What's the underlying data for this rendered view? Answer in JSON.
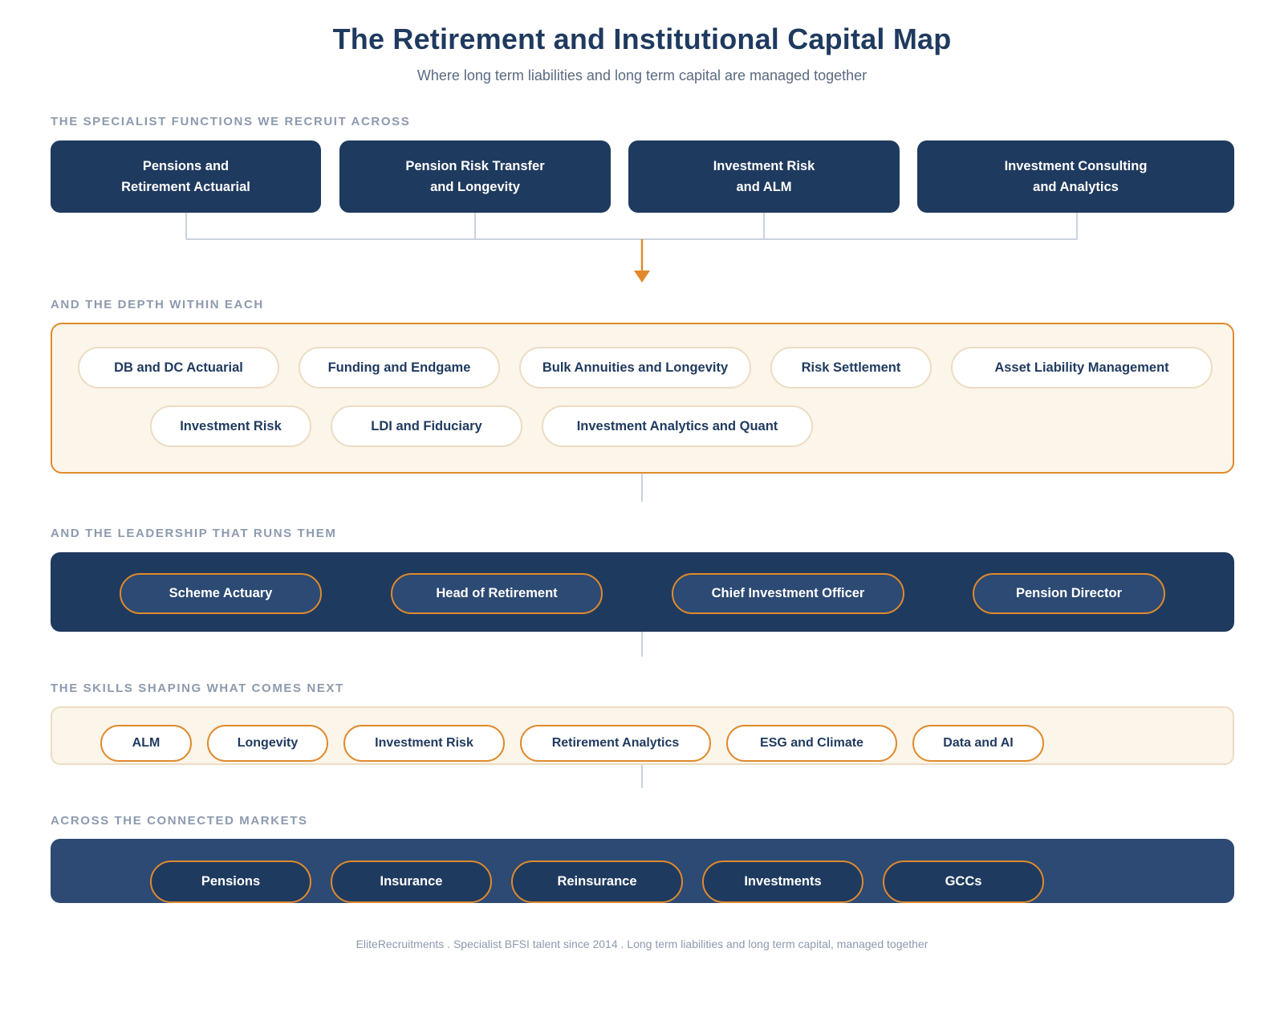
{
  "header": {
    "title": "The Retirement and Institutional Capital Map",
    "subtitle": "Where long term liabilities and long term capital are managed together"
  },
  "functions": {
    "label": "THE SPECIALIST FUNCTIONS WE RECRUIT ACROSS",
    "items": [
      {
        "line1": "Pensions and",
        "line2": "Retirement Actuarial"
      },
      {
        "line1": "Pension Risk Transfer",
        "line2": "and Longevity"
      },
      {
        "line1": "Investment Risk",
        "line2": "and ALM"
      },
      {
        "line1": "Investment Consulting",
        "line2": "and Analytics"
      }
    ]
  },
  "depth": {
    "label": "AND THE DEPTH WITHIN EACH",
    "items": [
      "DB and DC Actuarial",
      "Funding and Endgame",
      "Bulk Annuities and Longevity",
      "Risk Settlement",
      "Asset Liability Management",
      "Investment Risk",
      "LDI and Fiduciary",
      "Investment Analytics and Quant"
    ]
  },
  "leadership": {
    "label": "AND THE LEADERSHIP THAT RUNS THEM",
    "items": [
      "Scheme Actuary",
      "Head of Retirement",
      "Chief Investment Officer",
      "Pension Director"
    ]
  },
  "skills": {
    "label": "THE SKILLS SHAPING WHAT COMES NEXT",
    "items": [
      "ALM",
      "Longevity",
      "Investment Risk",
      "Retirement Analytics",
      "ESG and Climate",
      "Data and AI"
    ]
  },
  "markets": {
    "label": "ACROSS THE CONNECTED MARKETS",
    "items": [
      "Pensions",
      "Insurance",
      "Reinsurance",
      "Investments",
      "GCCs"
    ]
  },
  "footer": {
    "text": "EliteRecruitments . Specialist BFSI talent since 2014 . Long term liabilities and long term capital, managed together"
  },
  "colors": {
    "navy": "#1f3a5f",
    "navy_light": "#2c4a73",
    "accent_orange": "#e08a2c",
    "cream": "#fbf5ea",
    "label_gray": "#8d9aae"
  }
}
